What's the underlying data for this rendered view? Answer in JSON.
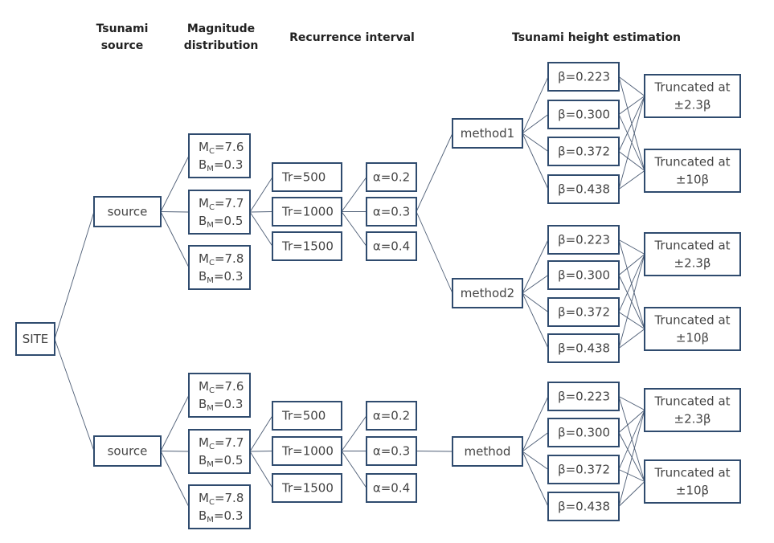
{
  "headers": {
    "tsunami_source": [
      "Tsunami",
      "source"
    ],
    "magnitude_distribution": [
      "Magnitude",
      "distribution"
    ],
    "recurrence_interval": "Recurrence interval",
    "tsunami_height_estimation": "Tsunami height estimation"
  },
  "site": "SITE",
  "source_label": "source",
  "magnitude": [
    {
      "mc": "=7.6",
      "bm": "=0.3"
    },
    {
      "mc": "=7.7",
      "bm": "=0.5"
    },
    {
      "mc": "=7.8",
      "bm": "=0.3"
    }
  ],
  "magnitude_symbols": {
    "m": "M",
    "m_sub": "C",
    "b": "B",
    "b_sub": "M"
  },
  "recurrence": [
    "Tr=500",
    "Tr=1000",
    "Tr=1500"
  ],
  "alpha": [
    "α=0.2",
    "α=0.3",
    "α=0.4"
  ],
  "methods_top": [
    "method1",
    "method2"
  ],
  "method_bottom": "method",
  "beta": [
    "β=0.223",
    "β=0.300",
    "β=0.372",
    "β=0.438"
  ],
  "truncation": [
    [
      "Truncated at",
      "±2.3β"
    ],
    [
      "Truncated at",
      "±10β"
    ]
  ],
  "colors": {
    "box_border": "#2f4b6e",
    "edge": "#4d5d75",
    "text": "#444444"
  }
}
